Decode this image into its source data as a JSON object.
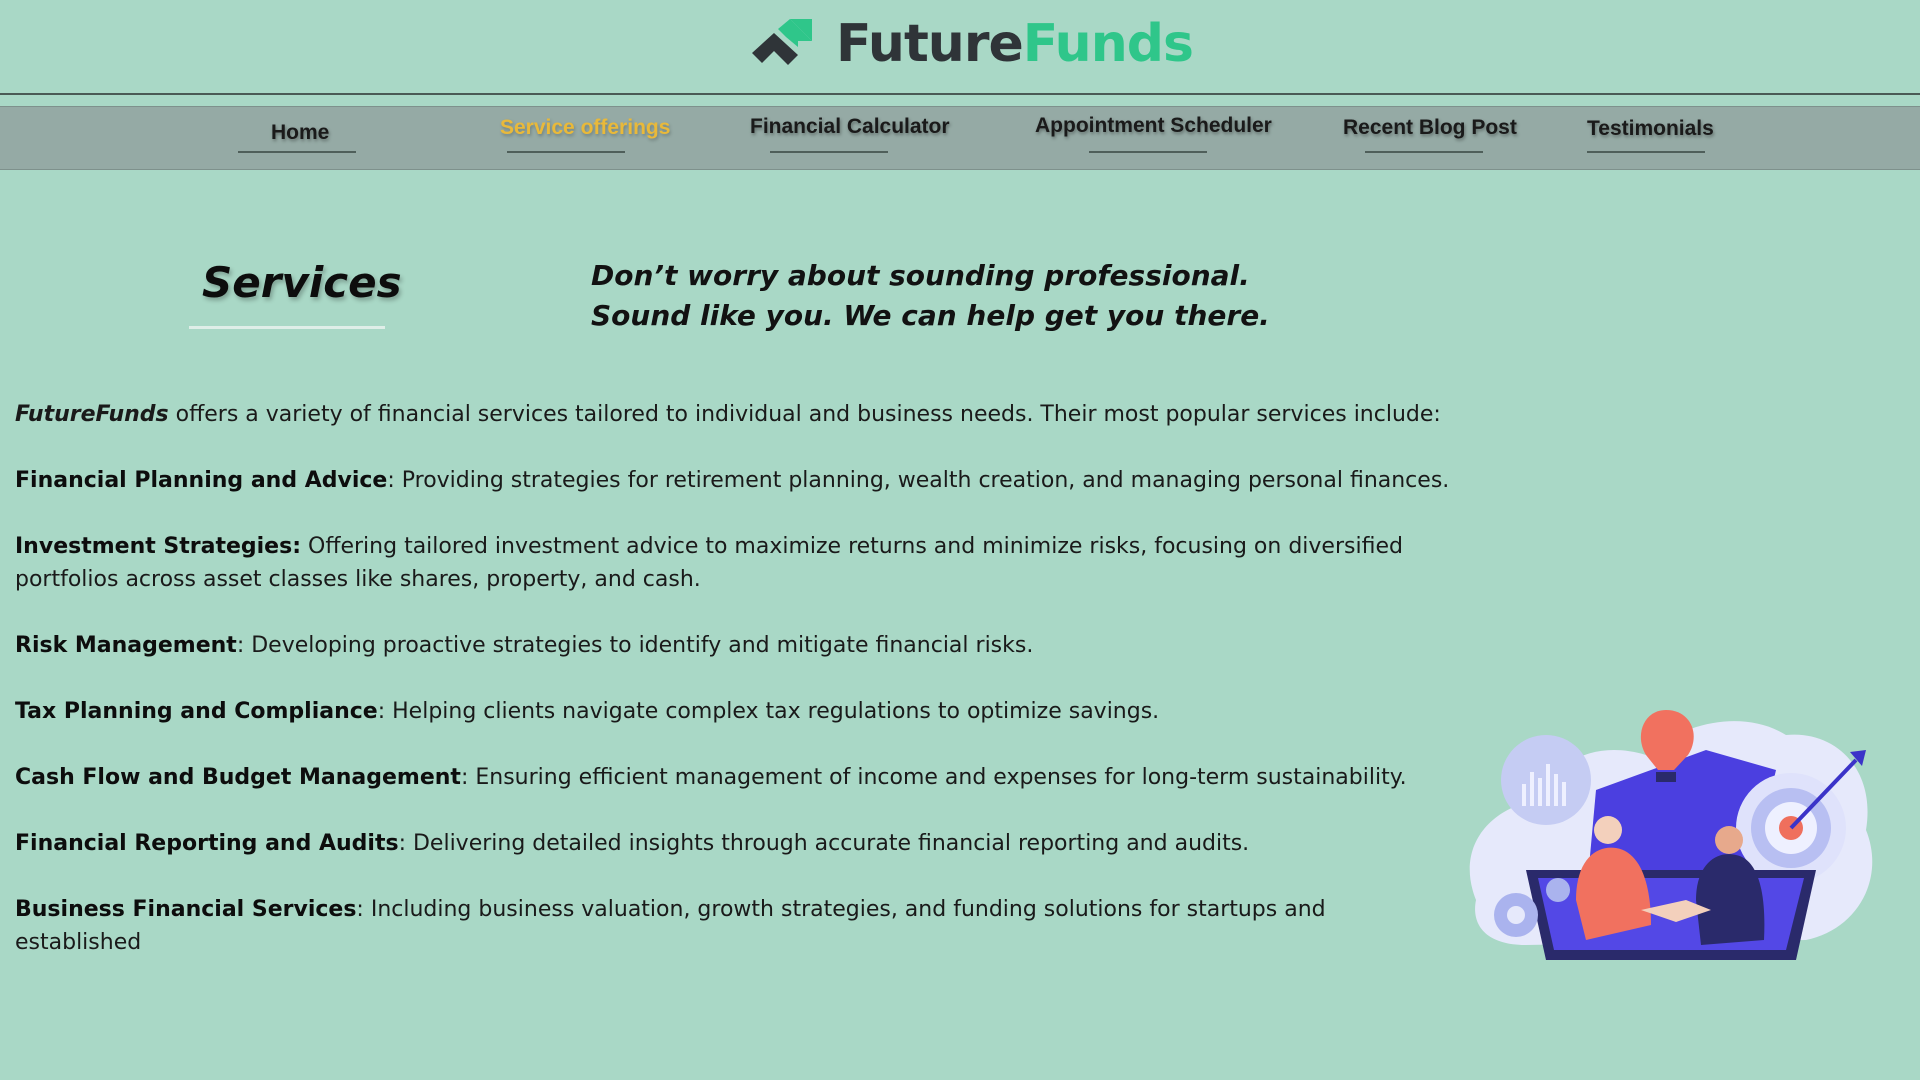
{
  "brand": {
    "name_part1": "Future",
    "name_part2": "Funds"
  },
  "nav": {
    "items": [
      {
        "label": "Home"
      },
      {
        "label": "Service offerings"
      },
      {
        "label": "Financial Calculator"
      },
      {
        "label": "Appointment Scheduler"
      },
      {
        "label": "Recent Blog Post"
      },
      {
        "label": "Testimonials"
      }
    ],
    "active_index": 1
  },
  "services": {
    "title": "Services",
    "tagline": "Don’t worry about sounding professional. Sound like you. We can help get you there."
  },
  "intro": {
    "brand": "FutureFunds",
    "text": " offers a variety of financial services tailored to individual and business needs. Their most popular services include:"
  },
  "service_list": [
    {
      "name": "Financial Planning and Advice",
      "sep": ": ",
      "desc": "Providing strategies for retirement planning, wealth creation, and managing personal finances."
    },
    {
      "name": "Investment Strategies:",
      "sep": " ",
      "desc": "Offering tailored investment advice to maximize returns and minimize risks, focusing on diversified portfolios across asset classes like shares, property, and cash."
    },
    {
      "name": "Risk Management",
      "sep": ": ",
      "desc": "Developing proactive strategies to identify and mitigate financial risks."
    },
    {
      "name": "Tax Planning and Compliance",
      "sep": ": ",
      "desc": "Helping clients navigate complex tax regulations to optimize savings."
    },
    {
      "name": "Cash Flow and Budget Management",
      "sep": ": ",
      "desc": "Ensuring efficient management of income and expenses for long-term sustainability."
    },
    {
      "name": "Financial Reporting and Audits",
      "sep": ": ",
      "desc": "Delivering detailed insights through accurate financial reporting and audits."
    },
    {
      "name": "Business Financial Services",
      "sep": ": ",
      "desc": "Including business valuation, growth strategies, and funding solutions for startups and established"
    }
  ],
  "colors": {
    "background": "#a9d8c6",
    "nav_bg": "#95aaa5",
    "brand_dark": "#2f3438",
    "brand_green": "#2fc68a",
    "active_nav": "#e9b93a"
  },
  "icons": {
    "logo": "chevron-up-logo-icon",
    "illustration": "business-handshake-illustration"
  }
}
